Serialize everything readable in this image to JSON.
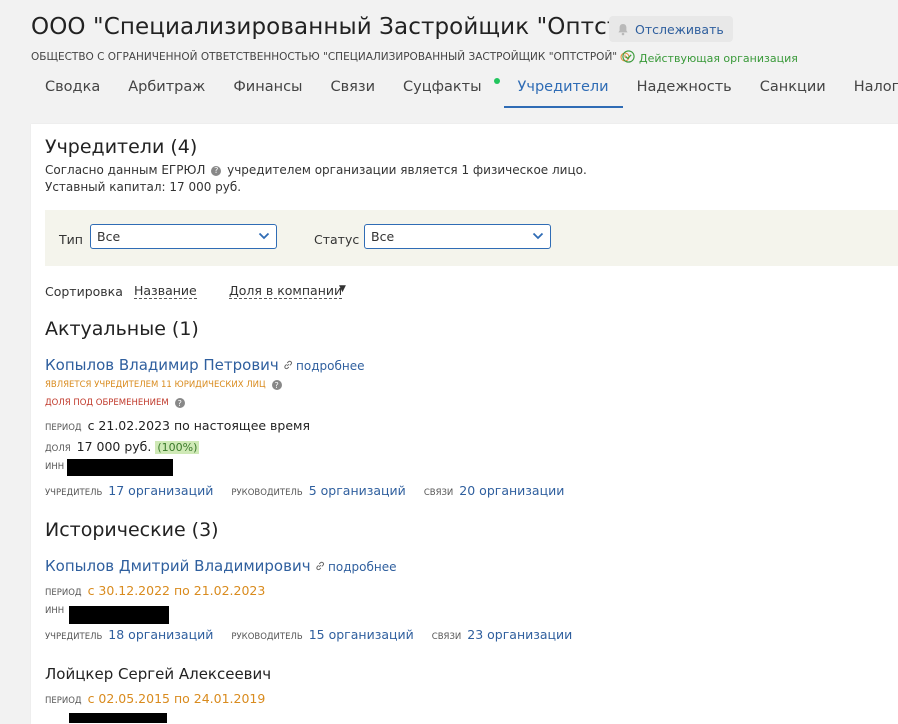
{
  "header": {
    "company_title": "ООО \"Специализированный Застройщик \"Оптстрой\"",
    "track_label": "Отслеживать",
    "full_name": "ОБЩЕСТВО С ОГРАНИЧЕННОЙ ОТВЕТСТВЕННОСТЬЮ \"СПЕЦИАЛИЗИРОВАННЫЙ ЗАСТРОЙЩИК \"ОПТСТРОЙ\"",
    "status": "Действующая организация"
  },
  "tabs": [
    {
      "label": "Сводка"
    },
    {
      "label": "Арбитраж"
    },
    {
      "label": "Финансы"
    },
    {
      "label": "Связи"
    },
    {
      "label": "Суцфакты"
    },
    {
      "label": "Учредители"
    },
    {
      "label": "Надежность"
    },
    {
      "label": "Санкции"
    },
    {
      "label": "Налоги"
    }
  ],
  "section": {
    "title": "Учредители (4)",
    "egrul_prefix": "Согласно данным ЕГРЮЛ",
    "egrul_suffix": "учредителем организации является 1 физическое лицо.",
    "capital": "Уставный капитал: 17 000 руб."
  },
  "filters": {
    "type_label": "Тип",
    "type_value": "Все",
    "status_label": "Статус",
    "status_value": "Все"
  },
  "sort": {
    "label": "Сортировка",
    "by_name": "Название",
    "by_share": "Доля в компании"
  },
  "current": {
    "heading": "Актуальные (1)",
    "person": {
      "name": "Копылов Владимир Петрович",
      "more": "подробнее",
      "badge_founder": "является учредителем 11 юридических лиц",
      "badge_encumbrance": "доля под обременением",
      "period_label": "период",
      "period_value": "с 21.02.2023 по настоящее время",
      "share_label": "доля",
      "share_value": "17 000 руб.",
      "share_pct": "(100%)",
      "inn_label": "инн",
      "founder_label": "учредитель",
      "founder_value": "17 организаций",
      "head_label": "руководитель",
      "head_value": "5 организаций",
      "links_label": "связи",
      "links_value": "20 организации"
    }
  },
  "historic": {
    "heading": "Исторические (3)",
    "person1": {
      "name": "Копылов Дмитрий Владимирович",
      "more": "подробнее",
      "period_label": "период",
      "period_value": "с 30.12.2022 по 21.02.2023",
      "inn_label": "инн",
      "founder_label": "учредитель",
      "founder_value": "18 организаций",
      "head_label": "руководитель",
      "head_value": "15 организаций",
      "links_label": "связи",
      "links_value": "23 организации"
    },
    "person2": {
      "name": "Лойцкер Сергей Алексеевич",
      "period_label": "период",
      "period_value": "с 02.05.2015 по 24.01.2019"
    }
  }
}
